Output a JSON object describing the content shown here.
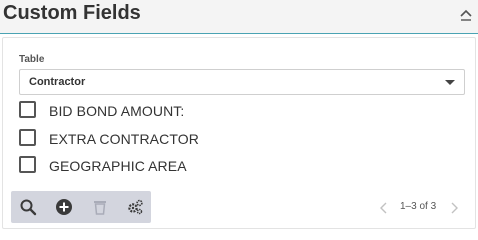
{
  "panel": {
    "title": "Custom Fields",
    "collapse_icon": "chevron-up-icon"
  },
  "table_selector": {
    "label": "Table",
    "selected": "Contractor"
  },
  "fields": [
    {
      "label": "BID BOND AMOUNT:",
      "checked": false
    },
    {
      "label": "EXTRA CONTRACTOR",
      "checked": false
    },
    {
      "label": "GEOGRAPHIC AREA",
      "checked": false
    }
  ],
  "toolbar": {
    "icons": [
      "search-icon",
      "add-icon",
      "trash-icon",
      "settings-icon"
    ]
  },
  "pager": {
    "range_text": "1–3 of 3"
  },
  "colors": {
    "header_bg": "#f4f4f4",
    "accent_line": "#4aa3b3",
    "toolbar_bg": "#d3d5de"
  }
}
